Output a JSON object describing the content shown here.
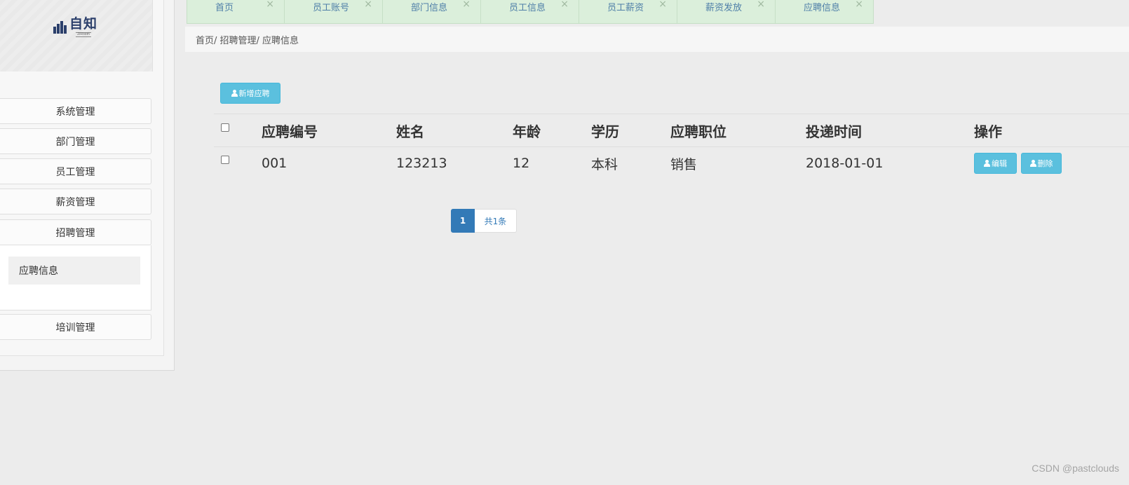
{
  "logo": {
    "text": "自知",
    "subtitle": "ZiRoom"
  },
  "sidebar": {
    "items": [
      {
        "label": "系统管理"
      },
      {
        "label": "部门管理"
      },
      {
        "label": "员工管理"
      },
      {
        "label": "薪资管理"
      },
      {
        "label": "招聘管理"
      },
      {
        "label": "培训管理"
      }
    ],
    "submenu": {
      "label": "应聘信息"
    }
  },
  "tabs": [
    {
      "label": "首页"
    },
    {
      "label": "员工账号"
    },
    {
      "label": "部门信息"
    },
    {
      "label": "员工信息"
    },
    {
      "label": "员工薪资"
    },
    {
      "label": "薪资发放"
    },
    {
      "label": "应聘信息"
    }
  ],
  "tab_close_glyph": "×",
  "breadcrumb": "首页/ 招聘管理/ 应聘信息",
  "toolbar": {
    "add_label": "新增应聘"
  },
  "table": {
    "headers": [
      "应聘编号",
      "姓名",
      "年龄",
      "学历",
      "应聘职位",
      "投递时间",
      "操作"
    ],
    "rows": [
      {
        "id": "001",
        "name": "123213",
        "age": "12",
        "education": "本科",
        "position": "销售",
        "date": "2018-01-01"
      }
    ],
    "edit_label": "编辑",
    "delete_label": "删除"
  },
  "pagination": {
    "current": "1",
    "total": "共1条"
  },
  "watermark": "CSDN @pastclouds",
  "colors": {
    "accent": "#5bc0de",
    "page_active": "#337ab7",
    "tab_bg": "#dbefdb",
    "background": "#ececec"
  }
}
